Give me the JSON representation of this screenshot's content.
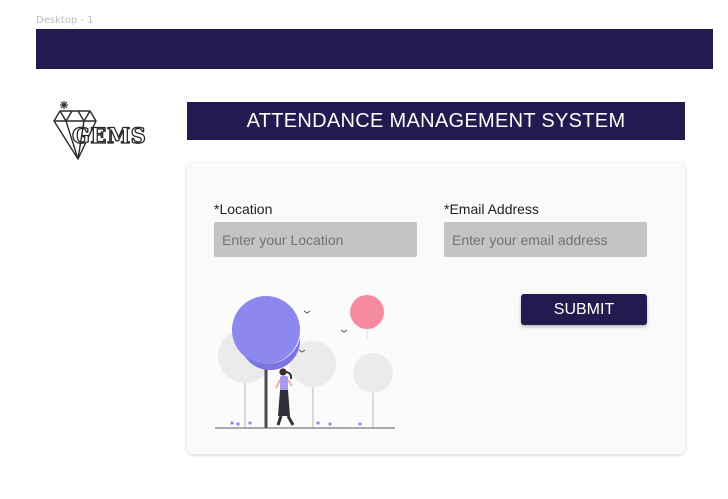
{
  "frame": {
    "label": "Desktop - 1"
  },
  "header": {
    "title": "ATTENDANCE MANAGEMENT SYSTEM"
  },
  "logo": {
    "text": "GEMS"
  },
  "form": {
    "location": {
      "label": "*Location",
      "placeholder": "Enter your Location"
    },
    "email": {
      "label": "*Email Address",
      "placeholder": "Enter your email address"
    },
    "submit_label": "SUBMIT"
  },
  "colors": {
    "primary": "#241a4f",
    "input_bg": "#c4c4c4",
    "accent_purple": "#8c88f0",
    "accent_pink": "#f68aa0"
  }
}
